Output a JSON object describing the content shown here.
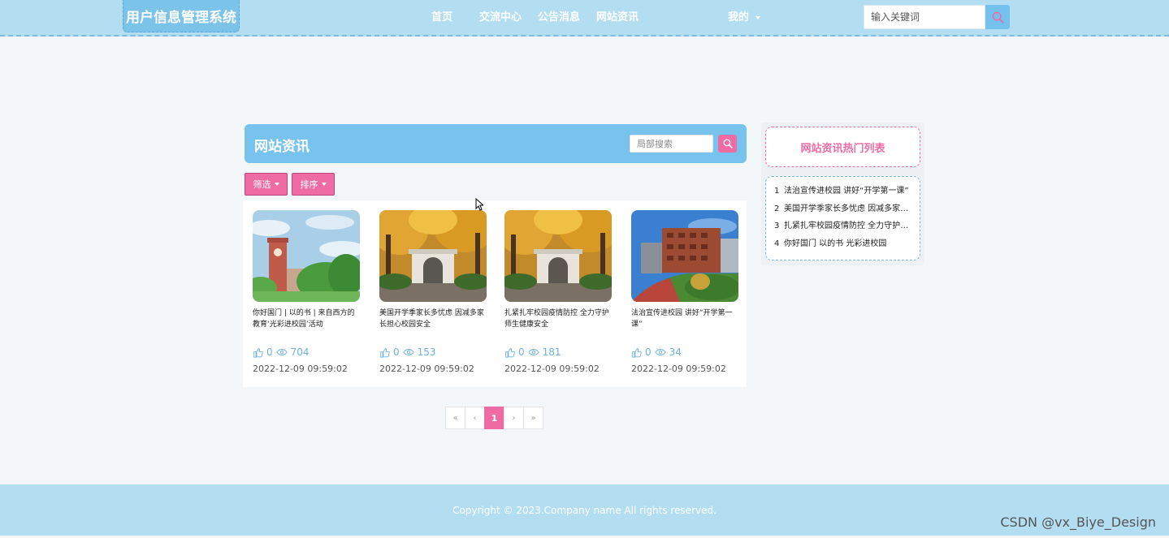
{
  "header": {
    "brand": "用户信息管理系统",
    "nav": [
      "首页",
      "交流中心",
      "公告消息",
      "网站资讯"
    ],
    "mine_label": "我的",
    "search_placeholder": "输入关键词"
  },
  "panel": {
    "title": "网站资讯",
    "local_search_placeholder": "局部搜索",
    "filter_label": "筛选",
    "sort_label": "排序"
  },
  "cards": [
    {
      "title": "你好国门 | 以的书 | 来自西方的教育‘光彩进校园’活动",
      "likes": "0",
      "views": "704",
      "date": "2022-12-09 09:59:02",
      "image": "campus-tower"
    },
    {
      "title": "美国开学季家长多忧虑 因减多家长担心校园安全",
      "likes": "0",
      "views": "153",
      "date": "2022-12-09 09:59:02",
      "image": "ginkgo-gate"
    },
    {
      "title": "扎紧扎牢校园疫情防控 全力守护师生健康安全",
      "likes": "0",
      "views": "181",
      "date": "2022-12-09 09:59:02",
      "image": "ginkgo-gate"
    },
    {
      "title": "法治宣传进校园 讲好“开学第一课”",
      "likes": "0",
      "views": "34",
      "date": "2022-12-09 09:59:02",
      "image": "brick-building"
    }
  ],
  "pagination": {
    "first": "«",
    "prev": "‹",
    "current": "1",
    "next": "›",
    "last": "»"
  },
  "hot": {
    "title": "网站资讯热门列表",
    "items": [
      {
        "num": "1",
        "text": "法治宣传进校园 讲好“开学第一课”"
      },
      {
        "num": "2",
        "text": "美国开学季家长多忧虑 因减多家长担心校园安全"
      },
      {
        "num": "3",
        "text": "扎紧扎牢校园疫情防控 全力守护师生健康安全"
      },
      {
        "num": "4",
        "text": "你好国门 以的书 光彩进校园"
      }
    ]
  },
  "footer": {
    "copyright": "Copyright © 2023.Company name All rights reserved."
  },
  "watermark": "CSDN @vx_Biye_Design",
  "colors": {
    "header_bg": "#b3def2",
    "accent_blue": "#78c2ee",
    "accent_pink": "#ee6ba4"
  }
}
